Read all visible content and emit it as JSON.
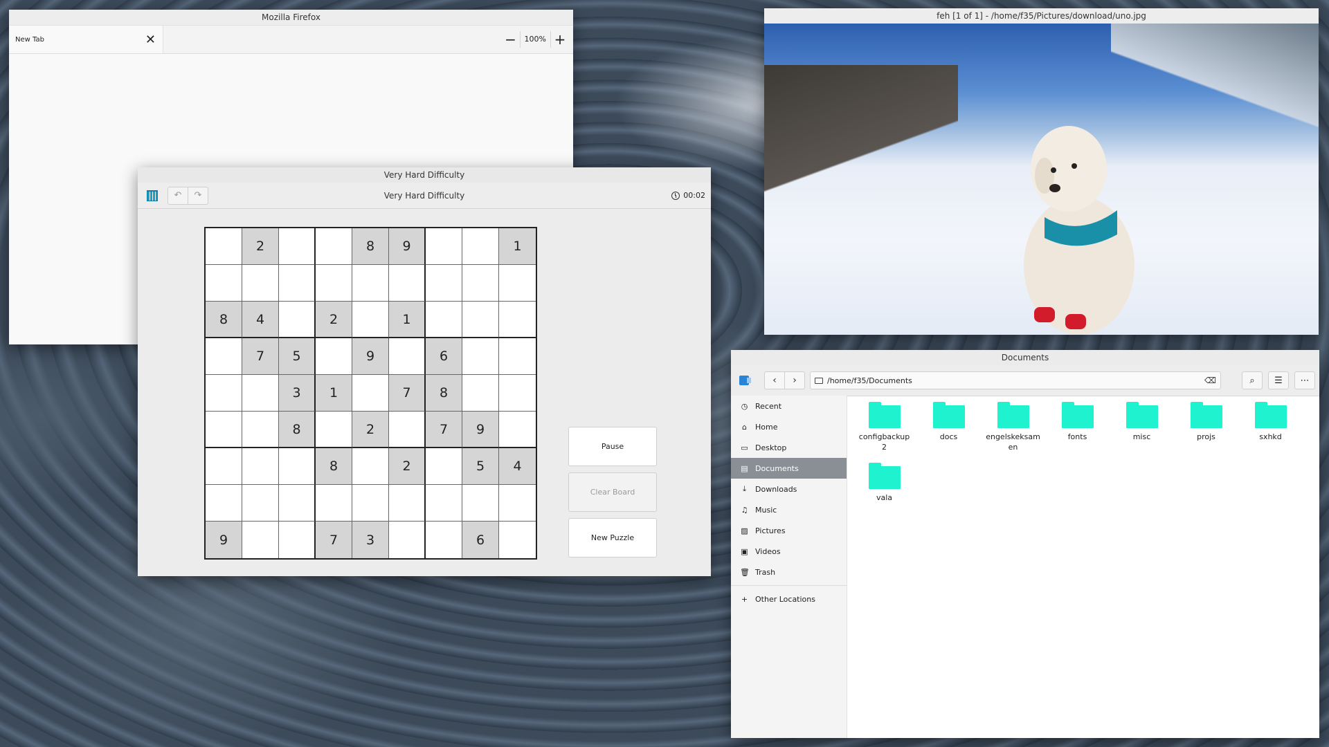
{
  "firefox": {
    "title": "Mozilla Firefox",
    "tab_label": "New Tab",
    "zoom_minus": "−",
    "zoom_value": "100%",
    "zoom_plus": "+"
  },
  "feh": {
    "title": "feh [1 of 1] - /home/f35/Pictures/download/uno.jpg"
  },
  "sudoku": {
    "title": "Very Hard Difficulty",
    "subtitle": "Very Hard Difficulty",
    "timer": "00:02",
    "undo_icon": "↶",
    "redo_icon": "↷",
    "grid": [
      [
        "",
        "2",
        "",
        "",
        "8",
        "9",
        "",
        "",
        "1"
      ],
      [
        "",
        "",
        "",
        "",
        "",
        "",
        "",
        "",
        ""
      ],
      [
        "8",
        "4",
        "",
        "2",
        "",
        "1",
        "",
        "",
        ""
      ],
      [
        "",
        "7",
        "5",
        "",
        "9",
        "",
        "6",
        "",
        ""
      ],
      [
        "",
        "",
        "3",
        "1",
        "",
        "7",
        "8",
        "",
        ""
      ],
      [
        "",
        "",
        "8",
        "",
        "2",
        "",
        "7",
        "9",
        ""
      ],
      [
        "",
        "",
        "",
        "8",
        "",
        "2",
        "",
        "5",
        "4"
      ],
      [
        "",
        "",
        "",
        "",
        "",
        "",
        "",
        "",
        ""
      ],
      [
        "9",
        "",
        "",
        "7",
        "3",
        "",
        "",
        "6",
        ""
      ]
    ],
    "buttons": {
      "pause": "Pause",
      "clear": "Clear Board",
      "new_puzzle": "New Puzzle"
    }
  },
  "files": {
    "title": "Documents",
    "path": "/home/f35/Documents",
    "sidebar": [
      {
        "label": "Recent",
        "icon": "◷",
        "name": "recent"
      },
      {
        "label": "Home",
        "icon": "⌂",
        "name": "home"
      },
      {
        "label": "Desktop",
        "icon": "▭",
        "name": "desktop"
      },
      {
        "label": "Documents",
        "icon": "▤",
        "name": "documents",
        "active": true
      },
      {
        "label": "Downloads",
        "icon": "⤓",
        "name": "downloads"
      },
      {
        "label": "Music",
        "icon": "♫",
        "name": "music"
      },
      {
        "label": "Pictures",
        "icon": "▨",
        "name": "pictures"
      },
      {
        "label": "Videos",
        "icon": "▣",
        "name": "videos"
      },
      {
        "label": "Trash",
        "icon": "🗑",
        "name": "trash"
      }
    ],
    "other_locations": "Other Locations",
    "folders": [
      "configbackup2",
      "docs",
      "engelskeksamen",
      "fonts",
      "misc",
      "projs",
      "sxhkd",
      "vala"
    ],
    "colors": {
      "folder": "#1ff2cf",
      "sidebar_active": "#8a8f96"
    }
  }
}
